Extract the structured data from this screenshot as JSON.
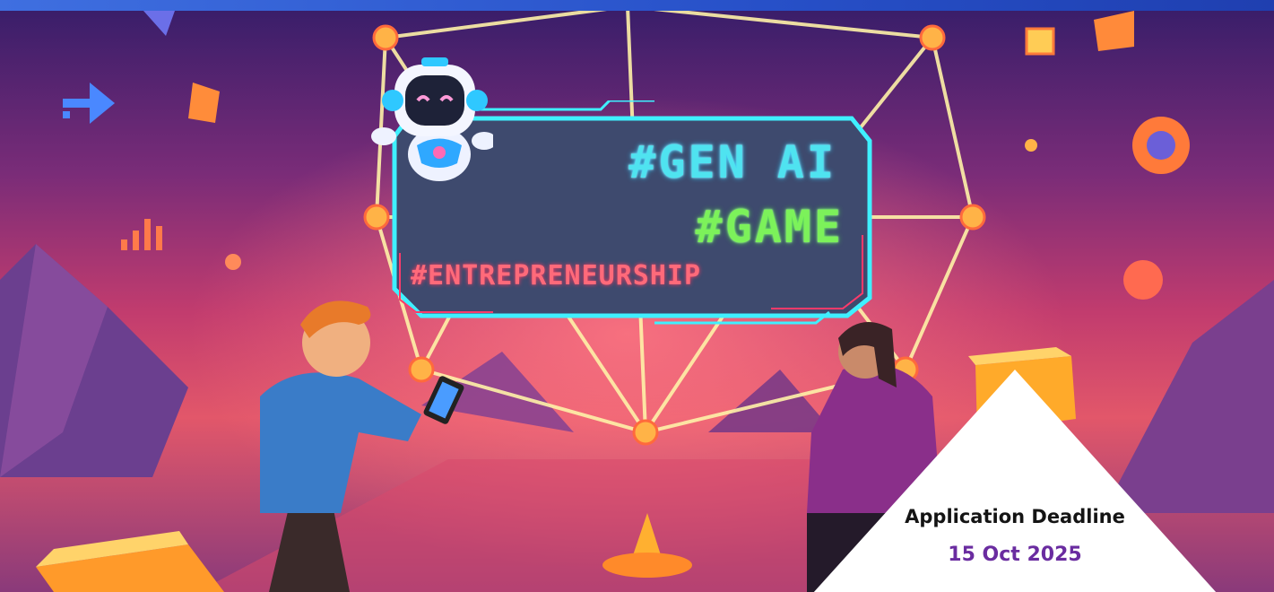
{
  "banner": {
    "tags": [
      "#GEN AI",
      "#GAME",
      "#ENTREPRENEURSHIP"
    ]
  },
  "deadline": {
    "title": "Application Deadline",
    "date": "15 Oct 2025"
  },
  "colors": {
    "top_bar": "#2f5fd6",
    "tag_genai": "#4fe3f0",
    "tag_game": "#7cf25a",
    "tag_entrepreneurship": "#ff6a7a",
    "deadline_date": "#6a2ca0"
  },
  "icons": [
    "robot-icon",
    "arrow-right-icon",
    "bar-chart-icon",
    "phone-icon"
  ]
}
